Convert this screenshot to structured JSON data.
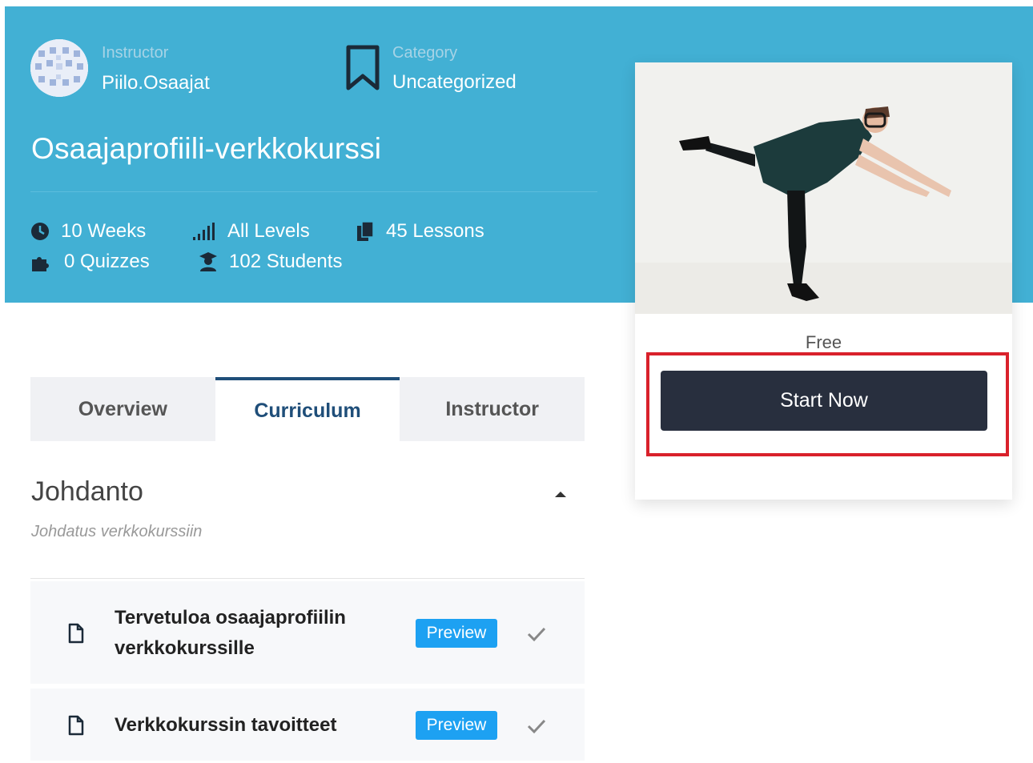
{
  "header": {
    "instructor_label": "Instructor",
    "instructor_name": "Piilo.Osaajat",
    "category_label": "Category",
    "category_value": "Uncategorized",
    "course_title": "Osaajaprofiili-verkkokurssi",
    "stats": {
      "duration": "10 Weeks",
      "level": "All Levels",
      "lessons": "45 Lessons",
      "quizzes": "0 Quizzes",
      "students": "102 Students"
    }
  },
  "card": {
    "price": "Free",
    "start_label": "Start Now"
  },
  "tabs": {
    "overview": "Overview",
    "curriculum": "Curriculum",
    "instructor": "Instructor"
  },
  "curriculum": {
    "section_title": "Johdanto",
    "section_desc": "Johdatus verkkokurssiin",
    "lessons": [
      {
        "title_line1": "Tervetuloa osaajaprofiilin",
        "title_line2": "verkkokurssille",
        "preview": "Preview"
      },
      {
        "title": "Verkkokurssin tavoitteet",
        "preview": "Preview"
      }
    ]
  },
  "colors": {
    "hero_bg": "#42b0d4",
    "button_bg": "#282f3e",
    "highlight": "#d9212b",
    "tab_active": "#1f4e79",
    "preview_bg": "#1da1f2"
  }
}
